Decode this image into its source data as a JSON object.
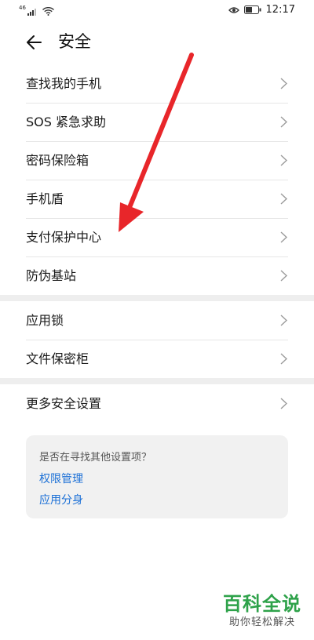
{
  "status_bar": {
    "signal_label": "46",
    "time": "12:17"
  },
  "header": {
    "title": "安全"
  },
  "section1": {
    "items": [
      {
        "label": "查找我的手机"
      },
      {
        "label": "SOS 紧急求助"
      },
      {
        "label": "密码保险箱"
      },
      {
        "label": "手机盾"
      },
      {
        "label": "支付保护中心"
      },
      {
        "label": "防伪基站"
      }
    ]
  },
  "section2": {
    "items": [
      {
        "label": "应用锁"
      },
      {
        "label": "文件保密柜"
      }
    ]
  },
  "section3": {
    "items": [
      {
        "label": "更多安全设置"
      }
    ]
  },
  "suggestion": {
    "question": "是否在寻找其他设置项？",
    "links": [
      {
        "label": "权限管理"
      },
      {
        "label": "应用分身"
      }
    ]
  },
  "watermark": {
    "main": "百科全说",
    "sub": "助你轻松解决"
  },
  "colors": {
    "link": "#1a6fd6",
    "annotation_arrow": "#e8262a",
    "watermark_green": "#2ea24a"
  }
}
